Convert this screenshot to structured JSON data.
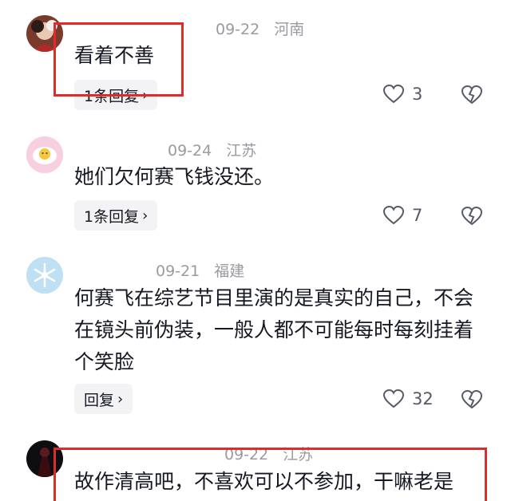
{
  "comments": [
    {
      "user": "",
      "date": "09-22",
      "location": "河南",
      "text": "看着不善",
      "reply_label": "1条回复",
      "likes": "3",
      "avatar_icon": "avatar-photo-icon"
    },
    {
      "user": "",
      "date": "09-24",
      "location": "江苏",
      "text": "她们欠何赛飞钱没还。",
      "reply_label": "1条回复",
      "likes": "7",
      "avatar_icon": "egg-avatar-icon"
    },
    {
      "user": "",
      "date": "09-21",
      "location": "福建",
      "text": "何赛飞在综艺节目里演的是真实的自己，不会在镜头前伪装，一般人都不可能每时每刻挂着个笑脸",
      "reply_label": "回复",
      "likes": "32",
      "avatar_icon": "snowflake-avatar-icon"
    },
    {
      "user": "",
      "date": "09-22",
      "location": "江苏",
      "text": "故作清高吧，不喜欢可以不参加，干嘛老是",
      "avatar_icon": "dark-avatar-icon"
    }
  ],
  "colors": {
    "highlight": "#e02b2b",
    "meta": "#9a9aa0",
    "text": "#161823"
  }
}
